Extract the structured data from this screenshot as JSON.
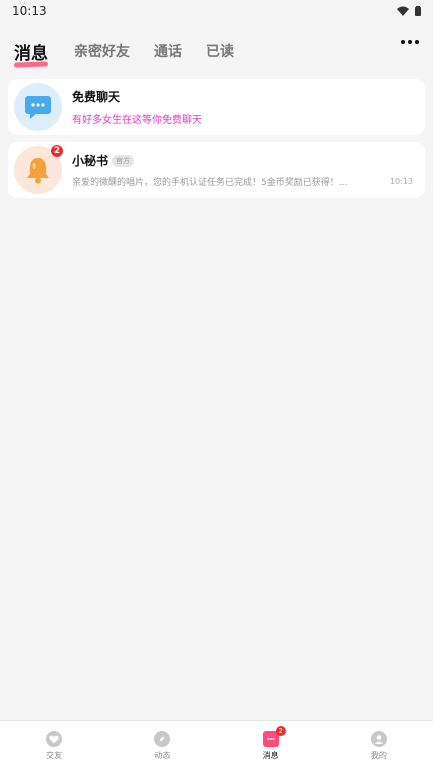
{
  "status_bar": {
    "time": "10:13"
  },
  "tabs": [
    {
      "label": "消息",
      "active": true
    },
    {
      "label": "亲密好友",
      "active": false
    },
    {
      "label": "通话",
      "active": false
    },
    {
      "label": "已读",
      "active": false
    }
  ],
  "conversations": [
    {
      "name": "免费聊天",
      "subtitle": "有好多女生在这等你免费聊天",
      "icon": "chat-bubble-icon"
    },
    {
      "name": "小秘书",
      "tag": "官方",
      "badge": "2",
      "preview": "亲爱的微醺的唱片，您的手机认证任务已完成！5金币奖励已获得！...",
      "time": "10:13",
      "icon": "bell-icon"
    }
  ],
  "bottom_nav": [
    {
      "label": "交友",
      "icon": "heart-icon"
    },
    {
      "label": "动态",
      "icon": "compass-icon"
    },
    {
      "label": "消息",
      "icon": "message-icon",
      "badge": "2",
      "active": true
    },
    {
      "label": "我的",
      "icon": "profile-icon"
    }
  ],
  "colors": {
    "accent": "#ff4d7a",
    "badge": "#ee2a2a",
    "pink_text": "#e23ec5"
  }
}
